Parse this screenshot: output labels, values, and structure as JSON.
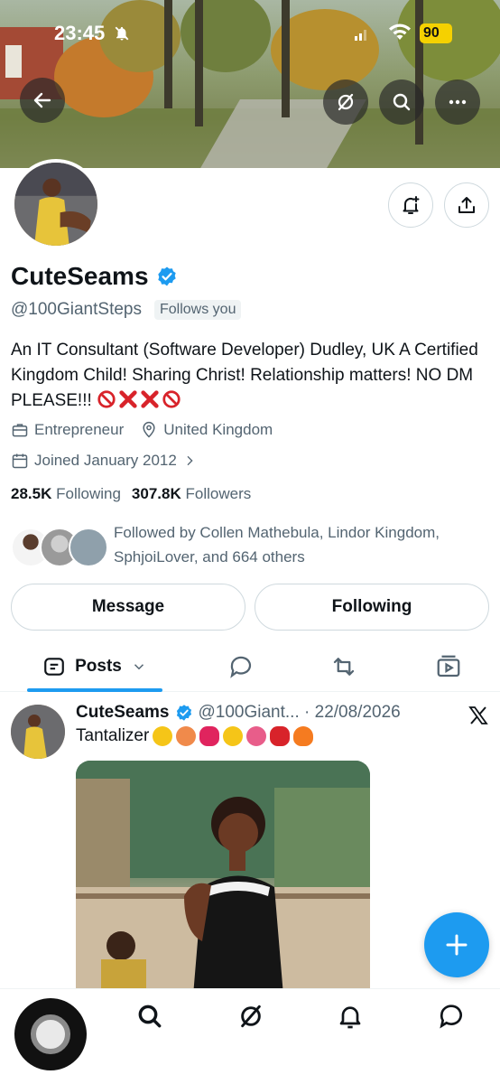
{
  "status_bar": {
    "time": "23:45",
    "battery": "90"
  },
  "profile": {
    "name": "CuteSeams",
    "handle": "@100GiantSteps",
    "follows_you": "Follows you",
    "bio": "An IT Consultant (Software Developer) Dudley, UK A Certified Kingdom Child! Sharing Christ! Relationship matters! NO DM PLEASE!!!",
    "bio_emojis": [
      "no-entry-emoji",
      "cross-mark-emoji",
      "cross-mark-emoji",
      "no-entry-emoji"
    ],
    "category": "Entrepreneur",
    "location": "United Kingdom",
    "joined": "Joined January 2012",
    "following_count": "28.5K",
    "following_label": "Following",
    "followers_count": "307.8K",
    "followers_label": "Followers",
    "followed_by": "Followed by Collen Mathebula, Lindor Kingdom, SphjoiLover, and 664 others"
  },
  "buttons": {
    "message": "Message",
    "following": "Following"
  },
  "tabs": {
    "posts": "Posts"
  },
  "post": {
    "name": "CuteSeams",
    "handle_date": "@100Giant... · 22/08/2026",
    "text": "Tantalizer",
    "emojis": [
      "heart-eyes-emoji",
      "peach-emoji",
      "kiss-emoji",
      "yum-emoji",
      "tongue-emoji",
      "pepper-emoji",
      "fire-emoji"
    ]
  },
  "colors": {
    "accent": "#1d9bf0",
    "text": "#0f1419",
    "muted": "#536471",
    "alert": "#d8232a"
  }
}
